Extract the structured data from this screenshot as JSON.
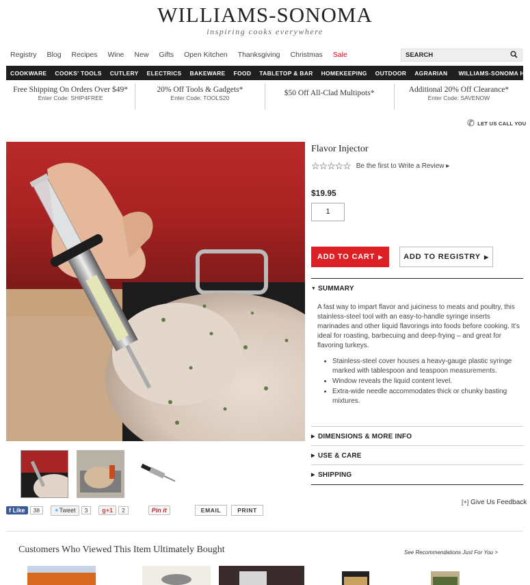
{
  "header": {
    "logo": "WILLIAMS-SONOMA",
    "tagline": "inspiring cooks everywhere"
  },
  "top_nav": [
    "Registry",
    "Blog",
    "Recipes",
    "Wine",
    "New",
    "Gifts",
    "Open Kitchen",
    "Thanksgiving",
    "Christmas",
    "Sale"
  ],
  "search": {
    "label": "SEARCH"
  },
  "categories": [
    "COOKWARE",
    "COOKS' TOOLS",
    "CUTLERY",
    "ELECTRICS",
    "BAKEWARE",
    "FOOD",
    "TABLETOP & BAR",
    "HOMEKEEPING",
    "OUTDOOR",
    "AGRARIAN",
    "WILLIAMS-SONOMA HOME"
  ],
  "promos": [
    {
      "title": "Free Shipping On Orders Over $49*",
      "code": "Enter Code: SHIP4FREE"
    },
    {
      "title": "20% Off Tools & Gadgets*",
      "code": "Enter Code: TOOLS20"
    },
    {
      "title": "$50 Off All-Clad Multipots*",
      "code": ""
    },
    {
      "title": "Additional 20% Off Clearance*",
      "code": "Enter Code: SAVENOW"
    }
  ],
  "call_us": "LET US CALL YOU",
  "product": {
    "title": "Flavor Injector",
    "rating_text": "Be the first to Write a Review",
    "price": "$19.95",
    "quantity": "1",
    "add_to_cart": "ADD TO CART",
    "add_to_registry": "ADD TO REGISTRY"
  },
  "accordion": {
    "summary": "SUMMARY",
    "summary_text": "A fast way to impart flavor and juiciness to meats and poultry, this stainless-steel tool with an easy-to-handle syringe inserts marinades and other liquid flavorings into foods before cooking. It's ideal for roasting, barbecuing and deep-frying – and great for flavoring turkeys.",
    "bullets": [
      "Stainless-steel cover houses a heavy-gauge plastic syringe marked with tablespoon and teaspoon measurements.",
      "Window reveals the liquid content level.",
      "Extra-wide needle accommodates thick or chunky basting mixtures."
    ],
    "dimensions": "DIMENSIONS & MORE INFO",
    "use_care": "USE & CARE",
    "shipping": "SHIPPING"
  },
  "social": {
    "fb_label": "Like",
    "fb_count": "38",
    "tw_label": "Tweet",
    "tw_count": "3",
    "gp_label": "+1",
    "gp_count": "2",
    "pin_label": "Pin it",
    "email": "EMAIL",
    "print": "PRINT"
  },
  "feedback": "Give Us Feedback",
  "recommendations": {
    "title": "Customers Who Viewed This Item Ultimately Bought",
    "see_link": "See Recommendations Just For You >"
  },
  "colors": {
    "accent_red": "#dd1f26",
    "nav_bg": "#1f1f1f",
    "facebook": "#3b5998"
  }
}
